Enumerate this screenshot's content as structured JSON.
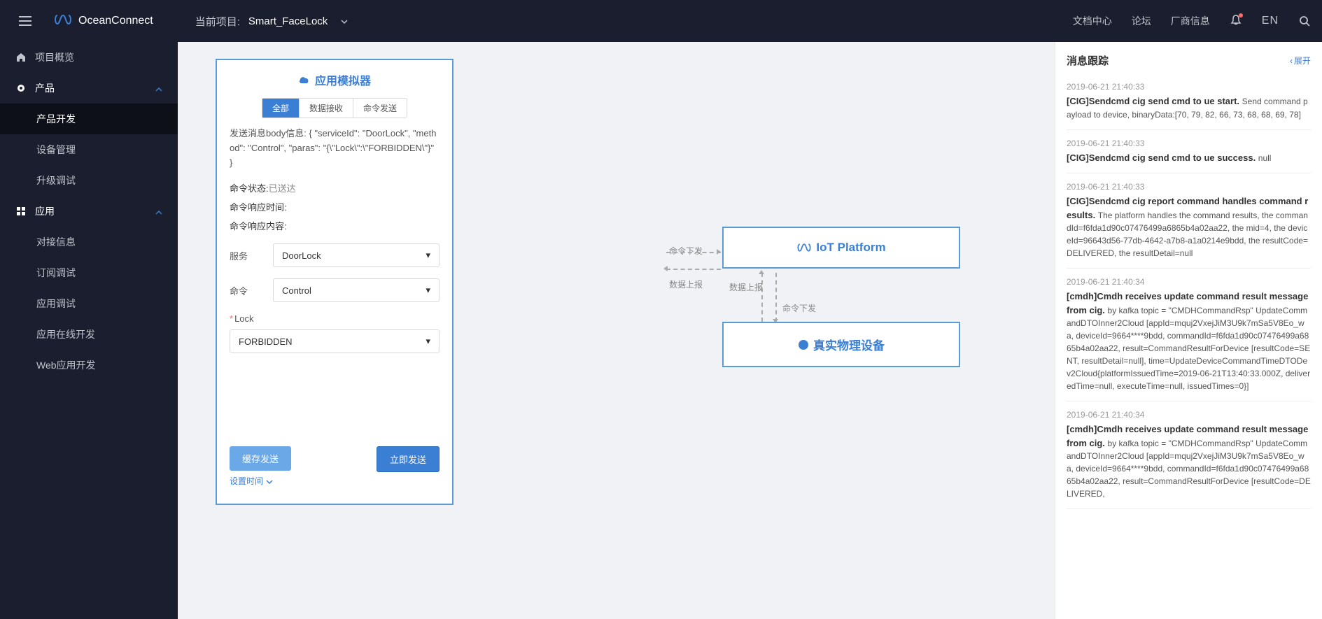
{
  "header": {
    "brand": "OceanConnect",
    "project_label": "当前项目:",
    "project_name": "Smart_FaceLock",
    "links": {
      "docs": "文档中心",
      "forum": "论坛",
      "vendor": "厂商信息"
    },
    "lang": "EN"
  },
  "sidebar": {
    "overview": "项目概览",
    "product": "产品",
    "product_dev": "产品开发",
    "device_mgmt": "设备管理",
    "upgrade_debug": "升级调试",
    "app": "应用",
    "conn_info": "对接信息",
    "sub_debug": "订阅调试",
    "app_debug": "应用调试",
    "online_dev": "应用在线开发",
    "web_dev": "Web应用开发"
  },
  "simulator": {
    "title": "应用模拟器",
    "tabs": {
      "all": "全部",
      "recv": "数据接收",
      "send": "命令发送"
    },
    "body_msg": "发送消息body信息: { \"serviceId\": \"DoorLock\", \"method\": \"Control\", \"paras\": \"{\\\"Lock\\\":\\\"FORBIDDEN\\\"}\" }",
    "status_label": "命令状态:",
    "status_value": "已送达",
    "resp_time_label": "命令响应时间:",
    "resp_content_label": "命令响应内容:",
    "service_label": "服务",
    "service_value": "DoorLock",
    "cmd_label": "命令",
    "cmd_value": "Control",
    "lock_label": "Lock",
    "lock_value": "FORBIDDEN",
    "btn_cache": "缓存发送",
    "btn_send": "立即发送",
    "time_setting": "设置时间"
  },
  "diagram": {
    "iot_platform": "IoT Platform",
    "real_device": "真实物理设备",
    "cmd_send": "命令下发",
    "data_report": "数据上报"
  },
  "trace": {
    "title": "消息跟踪",
    "expand": "展开",
    "logs": [
      {
        "time": "2019-06-21 21:40:33",
        "title": "[CIG]Sendcmd cig send cmd to ue start.",
        "body": "Send command payload to device, binaryData:[70, 79, 82, 66, 73, 68, 68, 69, 78]"
      },
      {
        "time": "2019-06-21 21:40:33",
        "title": "[CIG]Sendcmd cig send cmd to ue success.",
        "body": "null"
      },
      {
        "time": "2019-06-21 21:40:33",
        "title": "[CIG]Sendcmd cig report command handles command results.",
        "body": "The platform handles the command results, the commandId=f6fda1d90c07476499a6865b4a02aa22, the mid=4, the deviceId=96643d56-77db-4642-a7b8-a1a0214e9bdd, the resultCode=DELIVERED, the resultDetail=null"
      },
      {
        "time": "2019-06-21 21:40:34",
        "title": "[cmdh]Cmdh receives update command result message from cig.",
        "body": "by kafka topic = \"CMDHCommandRsp\" UpdateCommandDTOInner2Cloud [appId=mquj2VxejJiM3U9k7mSa5V8Eo_wa, deviceId=9664****9bdd, commandId=f6fda1d90c07476499a6865b4a02aa22, result=CommandResultForDevice [resultCode=SENT, resultDetail=null], time=UpdateDeviceCommandTimeDTODev2Cloud{platformIssuedTime=2019-06-21T13:40:33.000Z, deliveredTime=null, executeTime=null, issuedTimes=0}]"
      },
      {
        "time": "2019-06-21 21:40:34",
        "title": "[cmdh]Cmdh receives update command result message from cig.",
        "body": "by kafka topic = \"CMDHCommandRsp\" UpdateCommandDTOInner2Cloud [appId=mquj2VxejJiM3U9k7mSa5V8Eo_wa, deviceId=9664****9bdd, commandId=f6fda1d90c07476499a6865b4a02aa22, result=CommandResultForDevice [resultCode=DELIVERED,"
      }
    ]
  }
}
